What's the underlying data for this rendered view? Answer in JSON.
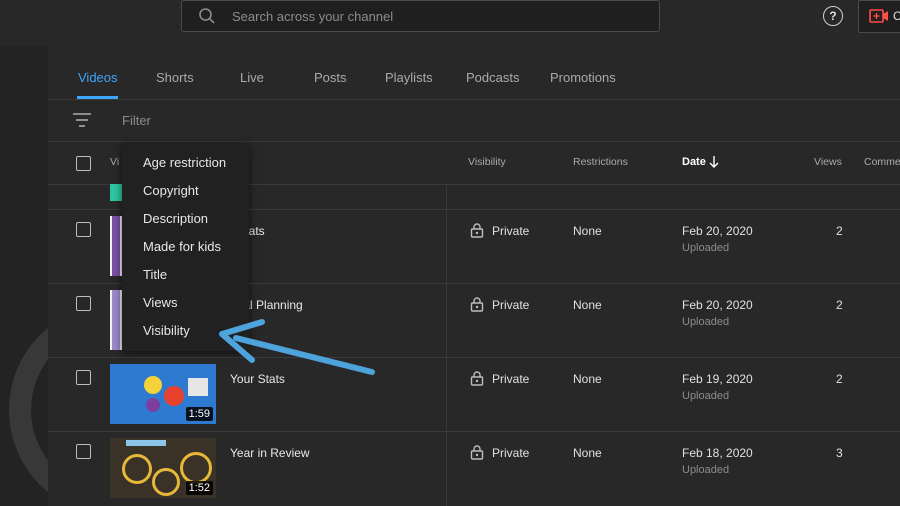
{
  "search": {
    "placeholder": "Search across your channel"
  },
  "header_icons": {
    "help": "?",
    "create_label": "C"
  },
  "tabs": [
    {
      "label": "Videos",
      "active": true
    },
    {
      "label": "Shorts"
    },
    {
      "label": "Live"
    },
    {
      "label": "Posts"
    },
    {
      "label": "Playlists"
    },
    {
      "label": "Podcasts"
    },
    {
      "label": "Promotions"
    }
  ],
  "filter": {
    "placeholder": "Filter"
  },
  "columns": {
    "video": "Vi",
    "visibility": "Visibility",
    "restrictions": "Restrictions",
    "date": "Date",
    "views": "Views",
    "comments": "Comme"
  },
  "menu": {
    "items": [
      "Age restriction",
      "Copyright",
      "Description",
      "Made for kids",
      "Title",
      "Views",
      "Visibility"
    ]
  },
  "rows": [
    {
      "title": "r Stats",
      "visibility": "Private",
      "restrictions": "None",
      "date": "Feb 20, 2020",
      "status": "Uploaded",
      "views": "2",
      "duration": ""
    },
    {
      "title": "nual Planning",
      "visibility": "Private",
      "restrictions": "None",
      "date": "Feb 20, 2020",
      "status": "Uploaded",
      "views": "2",
      "duration": ""
    },
    {
      "title": "Your Stats",
      "visibility": "Private",
      "restrictions": "None",
      "date": "Feb 19, 2020",
      "status": "Uploaded",
      "views": "2",
      "duration": "1:59"
    },
    {
      "title": "Year in Review",
      "visibility": "Private",
      "restrictions": "None",
      "date": "Feb 18, 2020",
      "status": "Uploaded",
      "views": "3",
      "duration": "1:52"
    }
  ],
  "colors": {
    "accent": "#3ea6ff",
    "arrow": "#4ea3dd"
  }
}
